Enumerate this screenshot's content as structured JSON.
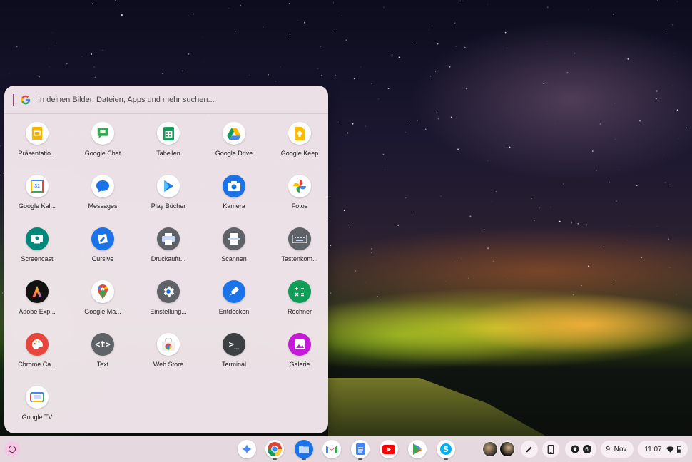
{
  "search": {
    "placeholder": "In deinen Bilder, Dateien, Apps und mehr suchen..."
  },
  "apps": [
    {
      "label": "Präsentatio...",
      "icon": "slides-icon"
    },
    {
      "label": "Google Chat",
      "icon": "chat-icon"
    },
    {
      "label": "Tabellen",
      "icon": "sheets-icon"
    },
    {
      "label": "Google Drive",
      "icon": "drive-icon"
    },
    {
      "label": "Google Keep",
      "icon": "keep-icon"
    },
    {
      "label": "Google Kal...",
      "icon": "calendar-icon",
      "icon_text": "31"
    },
    {
      "label": "Messages",
      "icon": "messages-icon"
    },
    {
      "label": "Play Bücher",
      "icon": "play-books-icon"
    },
    {
      "label": "Kamera",
      "icon": "camera-icon"
    },
    {
      "label": "Fotos",
      "icon": "photos-icon"
    },
    {
      "label": "Screencast",
      "icon": "screencast-icon"
    },
    {
      "label": "Cursive",
      "icon": "cursive-icon"
    },
    {
      "label": "Druckauftr...",
      "icon": "print-jobs-icon"
    },
    {
      "label": "Scannen",
      "icon": "scan-icon"
    },
    {
      "label": "Tastenkom...",
      "icon": "keyboard-shortcuts-icon"
    },
    {
      "label": "Adobe Exp...",
      "icon": "adobe-express-icon"
    },
    {
      "label": "Google Ma...",
      "icon": "maps-icon"
    },
    {
      "label": "Einstellung...",
      "icon": "settings-icon"
    },
    {
      "label": "Entdecken",
      "icon": "explore-icon"
    },
    {
      "label": "Rechner",
      "icon": "calculator-icon"
    },
    {
      "label": "Chrome Ca...",
      "icon": "chrome-canvas-icon"
    },
    {
      "label": "Text",
      "icon": "text-icon",
      "icon_text": "<t>"
    },
    {
      "label": "Web Store",
      "icon": "web-store-icon"
    },
    {
      "label": "Terminal",
      "icon": "terminal-icon",
      "icon_text": ">_"
    },
    {
      "label": "Galerie",
      "icon": "gallery-icon"
    },
    {
      "label": "Google TV",
      "icon": "google-tv-icon"
    }
  ],
  "shelf": {
    "apps": [
      "gemini-icon",
      "chrome-icon",
      "files-icon",
      "gmail-icon",
      "docs-icon",
      "youtube-icon",
      "play-store-icon",
      "skype-icon"
    ],
    "notification_count": "6",
    "date": "9. Nov.",
    "time": "11:07"
  },
  "colors": {
    "launcher_bg": "#f2e7ec",
    "shelf_bg": "#eee2e8",
    "accent": "#6a1e4a"
  }
}
